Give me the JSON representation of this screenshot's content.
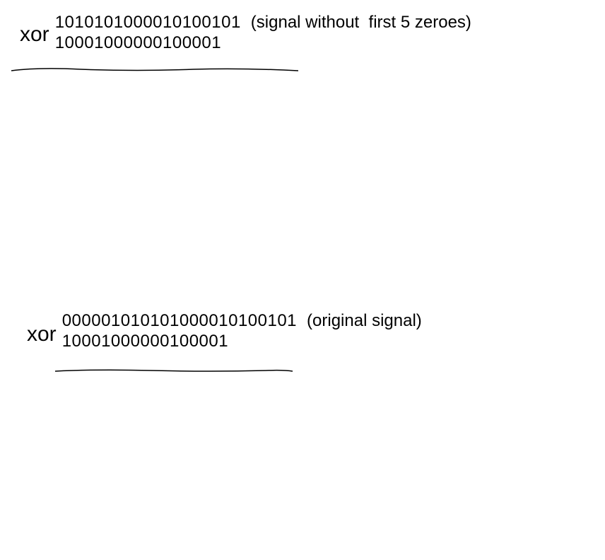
{
  "blocks": [
    {
      "label": "xor",
      "operand1": "1010101000010100101",
      "annotation": "(signal without  first 5 zeroes)",
      "operand2": "10001000000100001"
    },
    {
      "label": "xor",
      "operand1": "000001010101000010100101",
      "annotation": "(original signal)",
      "operand2": "10001000000100001"
    }
  ]
}
